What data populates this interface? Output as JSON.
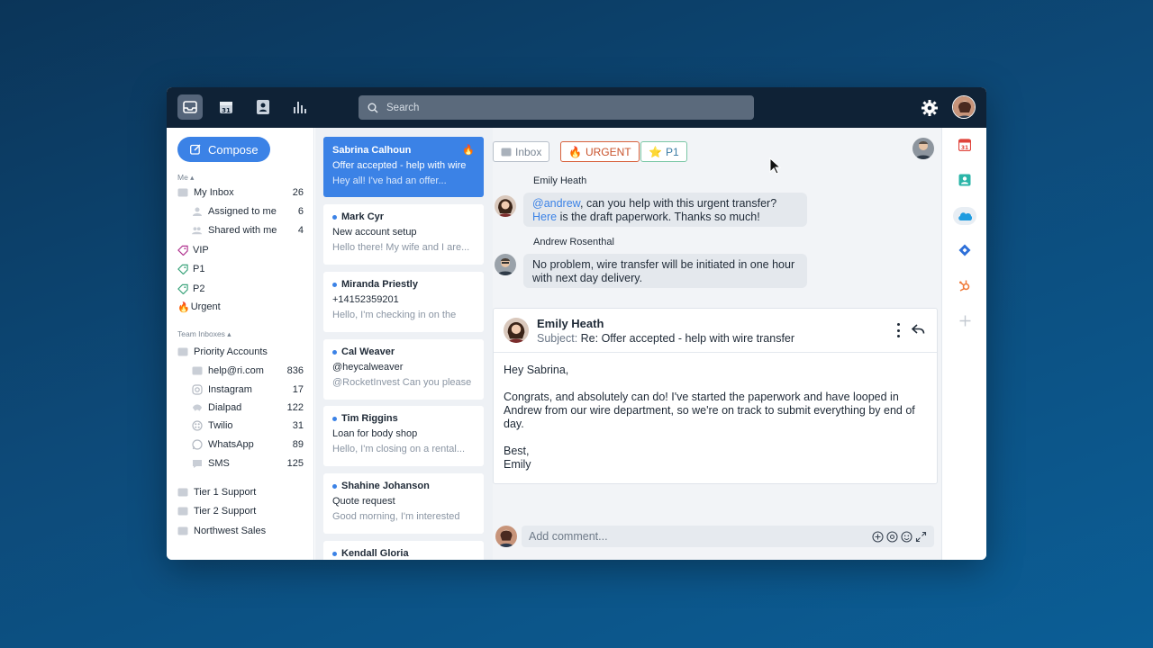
{
  "topbar": {
    "search_placeholder": "Search",
    "nav": [
      "inbox-icon",
      "calendar-icon",
      "contacts-icon",
      "analytics-icon"
    ],
    "calendar_day": "31"
  },
  "sidebar": {
    "compose_label": "Compose",
    "me_label": "Me",
    "me_items": [
      {
        "label": "My Inbox",
        "count": "26"
      },
      {
        "label": "Assigned to me",
        "count": "6"
      },
      {
        "label": "Shared with me",
        "count": "4"
      }
    ],
    "tags": [
      {
        "label": "VIP",
        "color": "#b0338f"
      },
      {
        "label": "P1",
        "color": "#3aa37a"
      },
      {
        "label": "P2",
        "color": "#3aa37a"
      },
      {
        "label": "Urgent",
        "color": "#d8613c"
      }
    ],
    "team_label": "Team Inboxes",
    "team_main": "Priority Accounts",
    "team_items": [
      {
        "label": "help@ri.com",
        "count": "836"
      },
      {
        "label": "Instagram",
        "count": "17"
      },
      {
        "label": "Dialpad",
        "count": "122"
      },
      {
        "label": "Twilio",
        "count": "31"
      },
      {
        "label": "WhatsApp",
        "count": "89"
      },
      {
        "label": "SMS",
        "count": "125"
      }
    ],
    "other_inboxes": [
      "Tier 1 Support",
      "Tier 2 Support",
      "Northwest Sales"
    ]
  },
  "conversations": [
    {
      "name": "Sabrina Calhoun",
      "subject": "Offer accepted - help with wire",
      "preview": "Hey all! I've had an offer..."
    },
    {
      "name": "Mark Cyr",
      "subject": "New account setup",
      "preview": "Hello there! My wife and I are..."
    },
    {
      "name": "Miranda Priestly",
      "subject": "+14152359201",
      "preview": "Hello, I'm checking in on the"
    },
    {
      "name": "Cal Weaver",
      "subject": "@heycalweaver",
      "preview": "@RocketInvest Can you please"
    },
    {
      "name": "Tim Riggins",
      "subject": "Loan for body shop",
      "preview": "Hello, I'm closing on a rental..."
    },
    {
      "name": "Shahine Johanson",
      "subject": "Quote request",
      "preview": "Good morning, I'm interested"
    },
    {
      "name": "Kendall Gloria",
      "subject": "",
      "preview": ""
    }
  ],
  "main": {
    "tags": {
      "inbox": "Inbox",
      "urgent": "URGENT",
      "p1": "P1"
    },
    "messages": [
      {
        "author": "Emily Heath",
        "mention": "@andrew",
        "line1_rest": ", can you help with this urgent transfer?",
        "link": "Here",
        "line2_rest": " is the draft paperwork. Thanks so much!"
      },
      {
        "author": "Andrew Rosenthal",
        "line1": "No problem, wire transfer will be initiated in one hour",
        "line2": "with next day delivery."
      }
    ],
    "email": {
      "from": "Emily Heath",
      "subject_label": "Subject:",
      "subject": "Re: Offer accepted - help with wire transfer",
      "greeting": "Hey Sabrina,",
      "body": "Congrats, and absolutely can do! I've started the paperwork and have looped in Andrew from our wire department, so we're on track to submit everything by end of day.",
      "signoff": "Best,",
      "signature": "Emily"
    },
    "comment_placeholder": "Add comment..."
  },
  "rail": [
    "calendar-app-icon",
    "contacts-app-icon",
    "salesforce-icon",
    "jira-icon",
    "hubspot-icon",
    "add-icon"
  ]
}
